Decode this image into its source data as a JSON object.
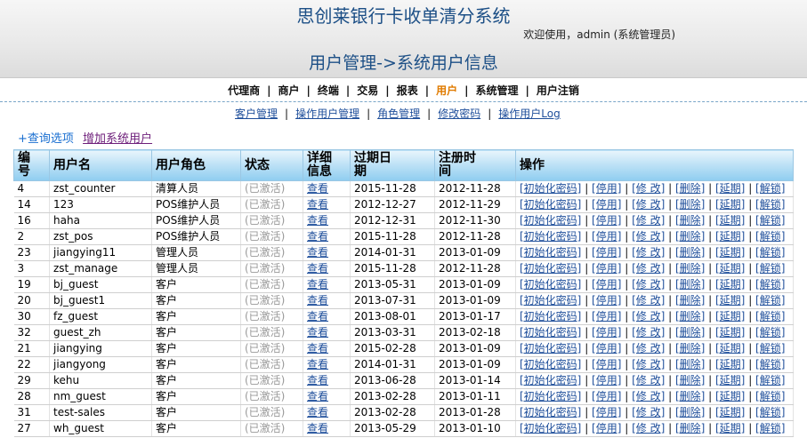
{
  "header": {
    "system_title": "思创莱银行卡收单清分系统",
    "welcome": "欢迎使用，admin (系统管理员)",
    "page_title": "用户管理->系统用户信息"
  },
  "nav": {
    "separator": "|",
    "items": [
      {
        "label": "代理商",
        "active": false
      },
      {
        "label": "商户",
        "active": false
      },
      {
        "label": "终端",
        "active": false
      },
      {
        "label": "交易",
        "active": false
      },
      {
        "label": "报表",
        "active": false
      },
      {
        "label": "用户",
        "active": true
      },
      {
        "label": "系统管理",
        "active": false
      },
      {
        "label": "用户注销",
        "active": false
      }
    ]
  },
  "subnav": {
    "separator": "|",
    "items": [
      "客户管理",
      "操作用户管理",
      "角色管理",
      "修改密码",
      "操作用户Log"
    ]
  },
  "actions": {
    "query": "+查询选项",
    "add_user": "增加系统用户"
  },
  "table": {
    "headers": [
      "编号",
      "用户名",
      "用户角色",
      "状态",
      "详细信息",
      "过期日期",
      "注册时间",
      "操作"
    ],
    "view_label": "查看",
    "operations": [
      "[初始化密码]",
      "[停用]",
      "[修 改]",
      "[删除]",
      "[延期]",
      "[解锁]"
    ],
    "op_separator": " | ",
    "rows": [
      {
        "id": "4",
        "username": "zst_counter",
        "role": "清算人员",
        "status": "(已激活)",
        "expire": "2015-11-28",
        "registered": "2012-11-28"
      },
      {
        "id": "14",
        "username": "123",
        "role": "POS维护人员",
        "status": "(已激活)",
        "expire": "2012-12-27",
        "registered": "2012-11-29"
      },
      {
        "id": "16",
        "username": "haha",
        "role": "POS维护人员",
        "status": "(已激活)",
        "expire": "2012-12-31",
        "registered": "2012-11-30"
      },
      {
        "id": "2",
        "username": "zst_pos",
        "role": "POS维护人员",
        "status": "(已激活)",
        "expire": "2015-11-28",
        "registered": "2012-11-28"
      },
      {
        "id": "23",
        "username": "jiangying11",
        "role": "管理人员",
        "status": "(已激活)",
        "expire": "2014-01-31",
        "registered": "2013-01-09"
      },
      {
        "id": "3",
        "username": "zst_manage",
        "role": "管理人员",
        "status": "(已激活)",
        "expire": "2015-11-28",
        "registered": "2012-11-28"
      },
      {
        "id": "19",
        "username": "bj_guest",
        "role": "客户",
        "status": "(已激活)",
        "expire": "2013-05-31",
        "registered": "2013-01-09"
      },
      {
        "id": "20",
        "username": "bj_guest1",
        "role": "客户",
        "status": "(已激活)",
        "expire": "2013-07-31",
        "registered": "2013-01-09"
      },
      {
        "id": "30",
        "username": "fz_guest",
        "role": "客户",
        "status": "(已激活)",
        "expire": "2013-08-01",
        "registered": "2013-01-17"
      },
      {
        "id": "32",
        "username": "guest_zh",
        "role": "客户",
        "status": "(已激活)",
        "expire": "2013-03-31",
        "registered": "2013-02-18"
      },
      {
        "id": "21",
        "username": "jiangying",
        "role": "客户",
        "status": "(已激活)",
        "expire": "2015-02-28",
        "registered": "2013-01-09"
      },
      {
        "id": "22",
        "username": "jiangyong",
        "role": "客户",
        "status": "(已激活)",
        "expire": "2014-01-31",
        "registered": "2013-01-09"
      },
      {
        "id": "29",
        "username": "kehu",
        "role": "客户",
        "status": "(已激活)",
        "expire": "2013-06-28",
        "registered": "2013-01-14"
      },
      {
        "id": "28",
        "username": "nm_guest",
        "role": "客户",
        "status": "(已激活)",
        "expire": "2013-02-28",
        "registered": "2013-01-11"
      },
      {
        "id": "31",
        "username": "test-sales",
        "role": "客户",
        "status": "(已激活)",
        "expire": "2013-02-28",
        "registered": "2013-01-28"
      },
      {
        "id": "27",
        "username": "wh_guest",
        "role": "客户",
        "status": "(已激活)",
        "expire": "2013-05-29",
        "registered": "2013-01-10"
      }
    ]
  },
  "colors": {
    "title_blue": "#1c4f86",
    "link_blue": "#1f4f9b",
    "active_nav": "#e07b00",
    "header_gradient_bottom": "#8fcdf0",
    "status_gray": "#999999"
  }
}
